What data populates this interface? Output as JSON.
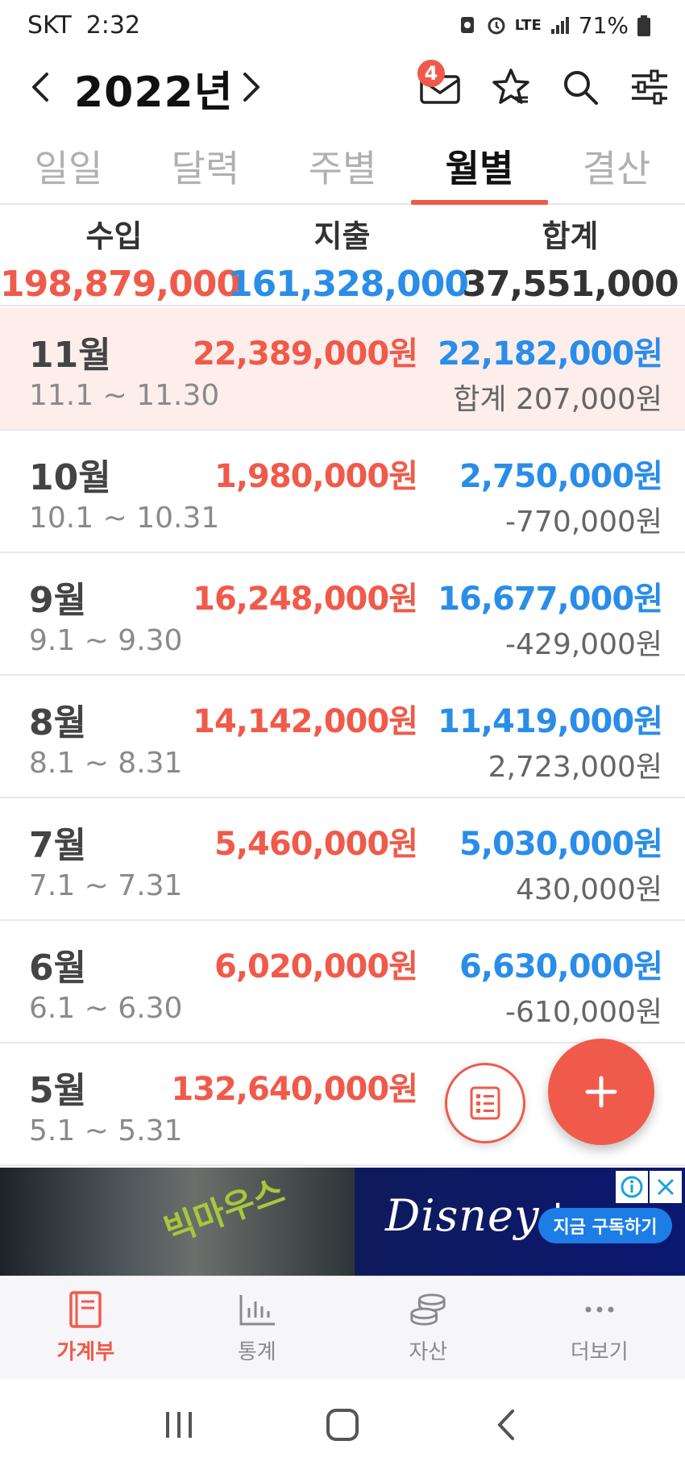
{
  "status_bar": {
    "carrier": "SKT",
    "time": "2:32",
    "network": "LTE",
    "battery": "71%"
  },
  "header": {
    "title": "2022년",
    "badge_count": "4",
    "icons": [
      "chevron-left-icon",
      "chevron-right-icon",
      "mail-icon",
      "star-icon",
      "search-icon",
      "filter-icon"
    ]
  },
  "tabs": [
    {
      "label": "일일",
      "active": false
    },
    {
      "label": "달력",
      "active": false
    },
    {
      "label": "주별",
      "active": false
    },
    {
      "label": "월별",
      "active": true
    },
    {
      "label": "결산",
      "active": false
    }
  ],
  "summary": {
    "income_label": "수입",
    "income_value": "198,879,000",
    "expense_label": "지출",
    "expense_value": "161,328,000",
    "total_label": "합계",
    "total_value": "37,551,000"
  },
  "months": [
    {
      "name": "11월",
      "range": "11.1 ~ 11.30",
      "income": "22,389,000원",
      "expense": "22,182,000원",
      "total": "합계 207,000원",
      "highlight": true
    },
    {
      "name": "10월",
      "range": "10.1 ~ 10.31",
      "income": "1,980,000원",
      "expense": "2,750,000원",
      "total": "-770,000원",
      "highlight": false
    },
    {
      "name": "9월",
      "range": "9.1 ~ 9.30",
      "income": "16,248,000원",
      "expense": "16,677,000원",
      "total": "-429,000원",
      "highlight": false
    },
    {
      "name": "8월",
      "range": "8.1 ~ 8.31",
      "income": "14,142,000원",
      "expense": "11,419,000원",
      "total": "2,723,000원",
      "highlight": false
    },
    {
      "name": "7월",
      "range": "7.1 ~ 7.31",
      "income": "5,460,000원",
      "expense": "5,030,000원",
      "total": "430,000원",
      "highlight": false
    },
    {
      "name": "6월",
      "range": "6.1 ~ 6.30",
      "income": "6,020,000원",
      "expense": "6,630,000원",
      "total": "-610,000원",
      "highlight": false
    },
    {
      "name": "5월",
      "range": "5.1 ~ 5.31",
      "income": "132,640,000원",
      "expense": "",
      "total": "",
      "highlight": false
    }
  ],
  "ad": {
    "logo": "Disney+",
    "cta": "지금 구독하기",
    "photo_text": "빅마우스"
  },
  "bottom_nav": [
    {
      "label": "가계부",
      "icon": "book-icon",
      "active": true
    },
    {
      "label": "통계",
      "icon": "bar-chart-icon",
      "active": false
    },
    {
      "label": "자산",
      "icon": "coins-icon",
      "active": false
    },
    {
      "label": "더보기",
      "icon": "more-icon",
      "active": false
    }
  ],
  "colors": {
    "accent": "#f05a4a",
    "income": "#f05a4a",
    "expense": "#2a8de8",
    "highlight_row": "#fdeeec"
  }
}
